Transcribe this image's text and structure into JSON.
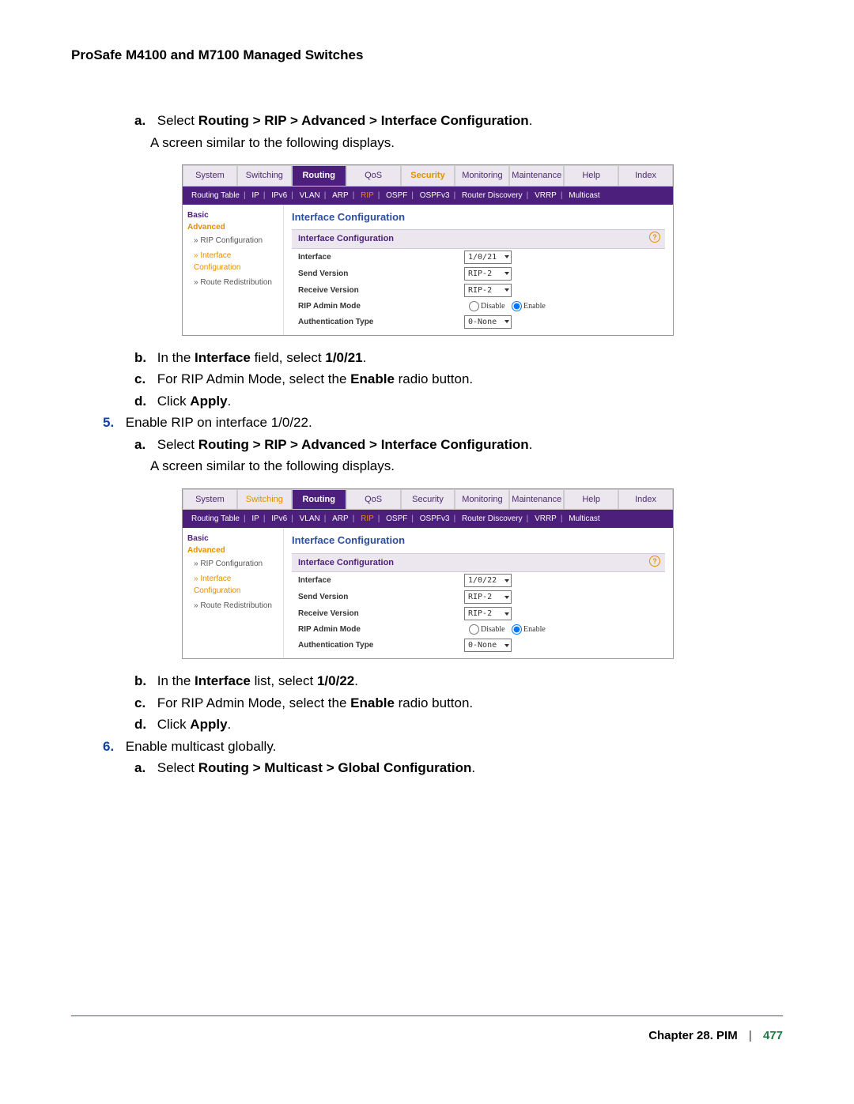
{
  "header": "ProSafe M4100 and M7100 Managed Switches",
  "steps": {
    "s_a1_marker": "a.",
    "s_a1_pre": "Select ",
    "s_a1_bold": "Routing > RIP > Advanced > Interface Configuration",
    "s_a1_post": ".",
    "s_a1_follow": "A screen similar to the following displays.",
    "s_b1_marker": "b.",
    "s_b1_p1": "In the ",
    "s_b1_b1": "Interface",
    "s_b1_p2": " field, select ",
    "s_b1_b2": "1/0/21",
    "s_b1_p3": ".",
    "s_c1_marker": "c.",
    "s_c1_p1": "For RIP Admin Mode, select the ",
    "s_c1_b1": "Enable",
    "s_c1_p2": " radio button.",
    "s_d1_marker": "d.",
    "s_d1_p1": "Click ",
    "s_d1_b1": "Apply",
    "s_d1_p2": ".",
    "s5_marker": "5.",
    "s5_text": "Enable RIP on interface 1/0/22.",
    "s_a2_marker": "a.",
    "s_a2_pre": "Select ",
    "s_a2_bold": "Routing > RIP > Advanced > Interface Configuration",
    "s_a2_post": ".",
    "s_a2_follow": "A screen similar to the following displays.",
    "s_b2_marker": "b.",
    "s_b2_p1": "In the ",
    "s_b2_b1": "Interface",
    "s_b2_p2": " list, select ",
    "s_b2_b2": "1/0/22",
    "s_b2_p3": ".",
    "s_c2_marker": "c.",
    "s_c2_p1": "For RIP Admin Mode, select the ",
    "s_c2_b1": "Enable",
    "s_c2_p2": " radio button.",
    "s_d2_marker": "d.",
    "s_d2_p1": "Click ",
    "s_d2_b1": "Apply",
    "s_d2_p2": ".",
    "s6_marker": "6.",
    "s6_text": "Enable multicast globally.",
    "s_a3_marker": "a.",
    "s_a3_pre": "Select ",
    "s_a3_bold": "Routing > Multicast > Global Configuration",
    "s_a3_post": "."
  },
  "shot1": {
    "tabs": [
      "System",
      "Switching",
      "Routing",
      "QoS",
      "Security",
      "Monitoring",
      "Maintenance",
      "Help",
      "Index"
    ],
    "activeTab": "Routing",
    "highlightTab": "Security",
    "subtabs": [
      "Routing Table",
      "IP",
      "IPv6",
      "VLAN",
      "ARP",
      "RIP",
      "OSPF",
      "OSPFv3",
      "Router Discovery",
      "VRRP",
      "Multicast"
    ],
    "subActive": "RIP",
    "sidebar": {
      "basic": "Basic",
      "advanced": "Advanced",
      "items": [
        "RIP Configuration",
        "Interface Configuration",
        "Route Redistribution"
      ],
      "selected": "Interface Configuration"
    },
    "panelTitle": "Interface Configuration",
    "barTitle": "Interface Configuration",
    "rows": {
      "interface": "Interface",
      "sendv": "Send Version",
      "recvv": "Receive Version",
      "admin": "RIP Admin Mode",
      "auth": "Authentication Type"
    },
    "vals": {
      "interface": "1/0/21",
      "sendv": "RIP-2",
      "recvv": "RIP-2",
      "disable": "Disable",
      "enable": "Enable",
      "auth": "0-None"
    }
  },
  "shot2": {
    "tabs": [
      "System",
      "Switching",
      "Routing",
      "QoS",
      "Security",
      "Monitoring",
      "Maintenance",
      "Help",
      "Index"
    ],
    "activeTab": "Routing",
    "highlightTab": "Switching",
    "subtabs": [
      "Routing Table",
      "IP",
      "IPv6",
      "VLAN",
      "ARP",
      "RIP",
      "OSPF",
      "OSPFv3",
      "Router Discovery",
      "VRRP",
      "Multicast"
    ],
    "subActive": "RIP",
    "sidebar": {
      "basic": "Basic",
      "advanced": "Advanced",
      "items": [
        "RIP Configuration",
        "Interface Configuration",
        "Route Redistribution"
      ],
      "selected": "Interface Configuration"
    },
    "panelTitle": "Interface Configuration",
    "barTitle": "Interface Configuration",
    "rows": {
      "interface": "Interface",
      "sendv": "Send Version",
      "recvv": "Receive Version",
      "admin": "RIP Admin Mode",
      "auth": "Authentication Type"
    },
    "vals": {
      "interface": "1/0/22",
      "sendv": "RIP-2",
      "recvv": "RIP-2",
      "disable": "Disable",
      "enable": "Enable",
      "auth": "0-None"
    }
  },
  "footer": {
    "chapter": "Chapter 28.  PIM",
    "sep": "|",
    "page": "477"
  }
}
